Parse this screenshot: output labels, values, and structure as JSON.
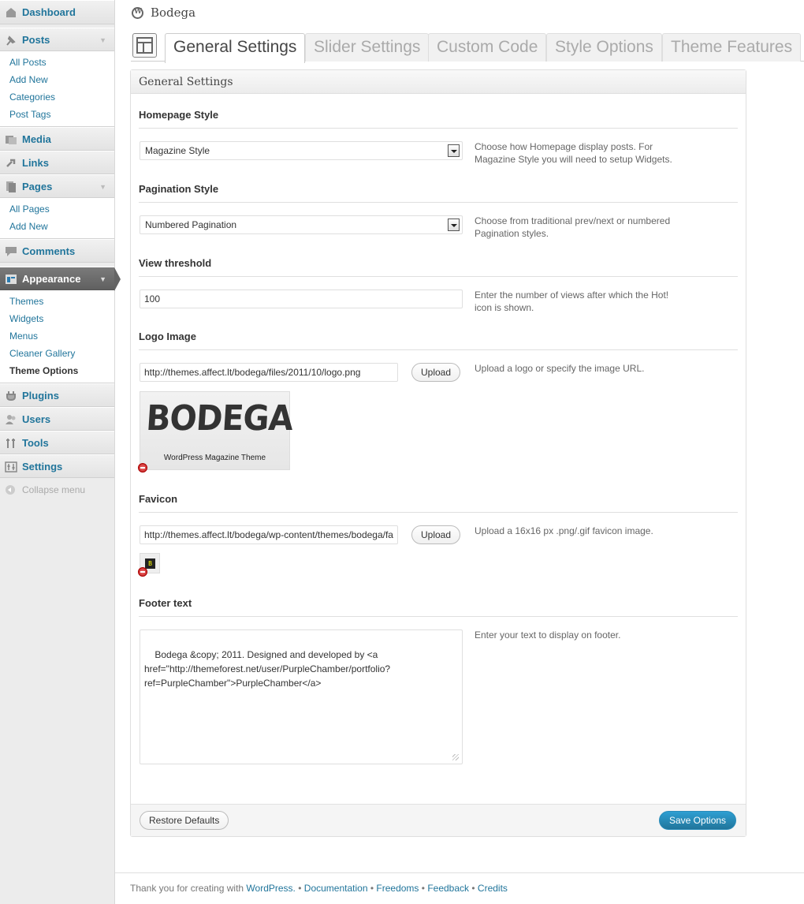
{
  "sidebar": {
    "dashboard": "Dashboard",
    "posts": {
      "label": "Posts",
      "items": [
        "All Posts",
        "Add New",
        "Categories",
        "Post Tags"
      ]
    },
    "media": "Media",
    "links": "Links",
    "pages": {
      "label": "Pages",
      "items": [
        "All Pages",
        "Add New"
      ]
    },
    "comments": "Comments",
    "appearance": {
      "label": "Appearance",
      "items": [
        "Themes",
        "Widgets",
        "Menus",
        "Cleaner Gallery",
        "Theme Options"
      ]
    },
    "plugins": "Plugins",
    "users": "Users",
    "tools": "Tools",
    "settings": "Settings",
    "collapse": "Collapse menu"
  },
  "header": {
    "site_title": "Bodega"
  },
  "tabs": [
    "General Settings",
    "Slider Settings",
    "Custom Code",
    "Style Options",
    "Theme Features"
  ],
  "panel": {
    "title": "General Settings",
    "homepage_style": {
      "title": "Homepage Style",
      "value": "Magazine Style",
      "desc": "Choose how Homepage display posts. For Magazine Style you will need to setup Widgets."
    },
    "pagination_style": {
      "title": "Pagination Style",
      "value": "Numbered Pagination",
      "desc": "Choose from traditional prev/next or numbered Pagination styles."
    },
    "view_threshold": {
      "title": "View threshold",
      "value": "100",
      "desc": "Enter the number of views after which the Hot! icon is shown."
    },
    "logo_image": {
      "title": "Logo Image",
      "value": "http://themes.affect.lt/bodega/files/2011/10/logo.png",
      "upload": "Upload",
      "desc": "Upload a logo or specify the image URL.",
      "preview_word": "BODEGA",
      "preview_sub": "WordPress Magazine Theme"
    },
    "favicon": {
      "title": "Favicon",
      "value": "http://themes.affect.lt/bodega/wp-content/themes/bodega/fa",
      "upload": "Upload",
      "desc": "Upload a 16x16 px .png/.gif favicon image.",
      "preview_glyph": "B"
    },
    "footer_text": {
      "title": "Footer text",
      "value": "Bodega &copy; 2011. Designed and developed by <a href=\"http://themeforest.net/user/PurpleChamber/portfolio?ref=PurpleChamber\">PurpleChamber</a>",
      "desc": "Enter your text to display on footer."
    },
    "restore_defaults": "Restore Defaults",
    "save_options": "Save Options"
  },
  "footer": {
    "prefix": "Thank you for creating with",
    "wordpress": "WordPress.",
    "documentation": "Documentation",
    "freedoms": "Freedoms",
    "feedback": "Feedback",
    "credits": "Credits",
    "sep": "•"
  }
}
